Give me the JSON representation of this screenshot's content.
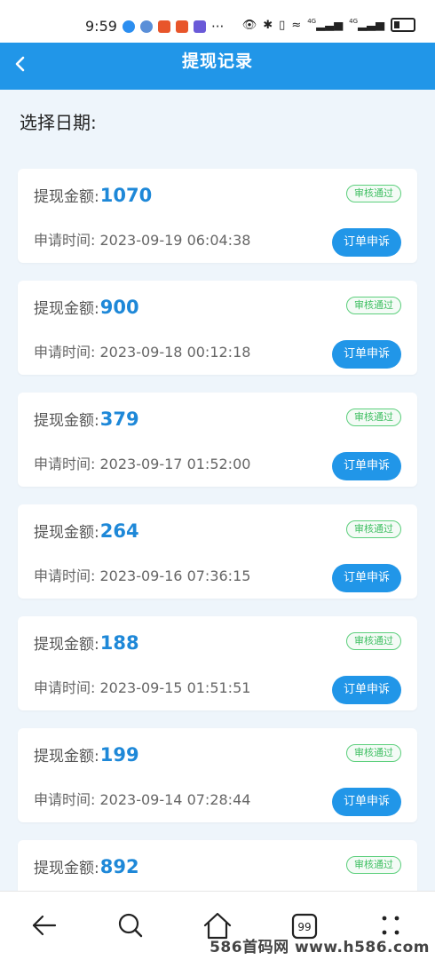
{
  "status_bar": {
    "time": "9:59",
    "more": "···",
    "signal_label_1": "4G",
    "signal_label_2": "4G"
  },
  "header": {
    "back_icon": "chevron-left-icon",
    "title": "提现记录"
  },
  "filter": {
    "date_label": "选择日期:"
  },
  "records": [
    {
      "amount_label": "提现金额:",
      "amount": "1070",
      "status": "审核通过",
      "time_label": "申请时间:",
      "time": "2023-09-19 06:04:38",
      "action": "订单申诉"
    },
    {
      "amount_label": "提现金额:",
      "amount": "900",
      "status": "审核通过",
      "time_label": "申请时间:",
      "time": "2023-09-18 00:12:18",
      "action": "订单申诉"
    },
    {
      "amount_label": "提现金额:",
      "amount": "379",
      "status": "审核通过",
      "time_label": "申请时间:",
      "time": "2023-09-17 01:52:00",
      "action": "订单申诉"
    },
    {
      "amount_label": "提现金额:",
      "amount": "264",
      "status": "审核通过",
      "time_label": "申请时间:",
      "time": "2023-09-16 07:36:15",
      "action": "订单申诉"
    },
    {
      "amount_label": "提现金额:",
      "amount": "188",
      "status": "审核通过",
      "time_label": "申请时间:",
      "time": "2023-09-15 01:51:51",
      "action": "订单申诉"
    },
    {
      "amount_label": "提现金额:",
      "amount": "199",
      "status": "审核通过",
      "time_label": "申请时间:",
      "time": "2023-09-14 07:28:44",
      "action": "订单申诉"
    },
    {
      "amount_label": "提现金额:",
      "amount": "892",
      "status": "审核通过",
      "time_label": "申请时间:",
      "time": "",
      "action": ""
    }
  ],
  "bottom_nav": {
    "tabs_count_badge": "99",
    "icons": [
      "back-arrow-icon",
      "search-icon",
      "home-icon",
      "tabs-icon",
      "menu-dots-icon"
    ]
  },
  "watermark": "586首码网 www.h586.com",
  "colors": {
    "accent": "#2196e8",
    "amount": "#1e88d8",
    "badge_green": "#3fbf62",
    "page_bg": "#eef5fb"
  }
}
